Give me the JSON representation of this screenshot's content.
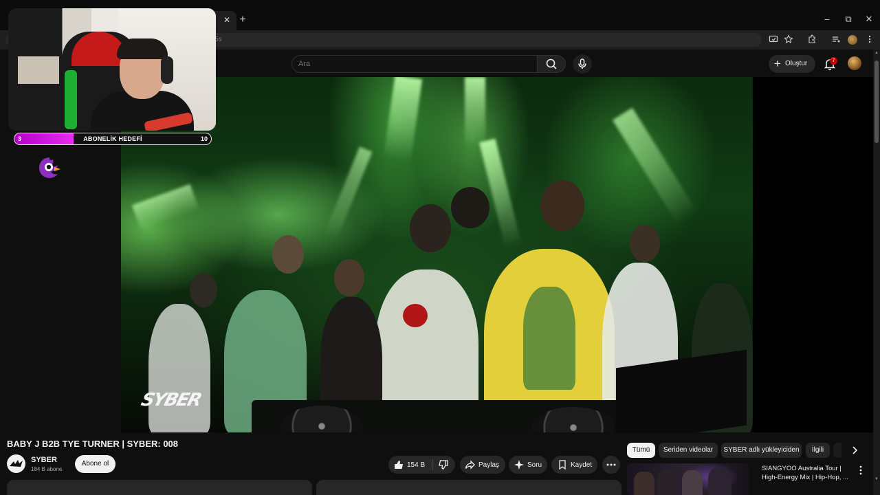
{
  "browser": {
    "window_controls": [
      "–",
      "⧉",
      "✕"
    ],
    "tab_close": "✕",
    "new_tab": "+",
    "address_fragment": "5s"
  },
  "header": {
    "search_placeholder": "Ara",
    "create_label": "Oluştur",
    "notification_count": "7"
  },
  "overlay": {
    "goal": {
      "label": "ABONELİK HEDEFİ",
      "current": "3",
      "target": "10",
      "progress_fraction": 0.3
    }
  },
  "video": {
    "watermark": "SYBER"
  },
  "watch": {
    "title": "BABY J B2B TYE TURNER | SYBER: 008",
    "channel_name": "SYBER",
    "subscribers": "184 B abone",
    "subscribe_label": "Abone ol",
    "like_count": "154 B",
    "share_label": "Paylaş",
    "ask_label": "Soru",
    "save_label": "Kaydet"
  },
  "sidebar": {
    "chips": [
      "Tümü",
      "Seriden videolar",
      "SYBER adlı yükleyiciden",
      "İlgili"
    ],
    "active_chip": 0,
    "recommendation": {
      "title": "SIANGYOO Australia Tour | High-Energy Mix | Hip-Hop, ..."
    }
  },
  "colors": {
    "background": "#0f0f0f",
    "goal_fill": "#e82cf0",
    "badge": "#cc0000",
    "video_tint": "#103a14"
  },
  "icons": [
    "search-icon",
    "mic-icon",
    "plus-icon",
    "bell-icon",
    "like-icon",
    "dislike-icon",
    "share-icon",
    "sparkle-icon",
    "bookmark-icon",
    "more-icon",
    "chevron-right-icon"
  ]
}
